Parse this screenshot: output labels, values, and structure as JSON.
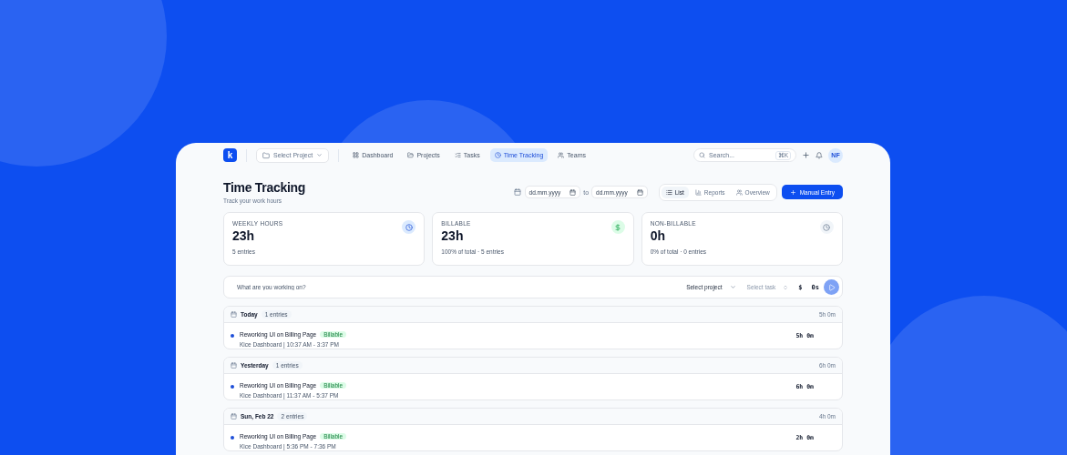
{
  "nav": {
    "logo": "k",
    "project_select": "Select Project",
    "links": [
      {
        "label": "Dashboard",
        "selected": false
      },
      {
        "label": "Projects",
        "selected": false
      },
      {
        "label": "Tasks",
        "selected": false
      },
      {
        "label": "Time Tracking",
        "selected": true
      },
      {
        "label": "Teams",
        "selected": false
      }
    ],
    "search": {
      "placeholder": "Search...",
      "shortcut": "⌘K"
    },
    "avatar": "NF"
  },
  "header": {
    "title": "Time Tracking",
    "subtitle": "Track your work hours",
    "date_from": "dd.mm.yyyy",
    "to_label": "to",
    "date_to": "dd.mm.yyyy",
    "views": [
      {
        "label": "List",
        "selected": true
      },
      {
        "label": "Reports",
        "selected": false
      },
      {
        "label": "Overview",
        "selected": false
      }
    ],
    "add_button": "Manual Entry"
  },
  "stats": [
    {
      "label": "WEEKLY HOURS",
      "value": "23h",
      "note": "5 entries"
    },
    {
      "label": "BILLABLE",
      "value": "23h",
      "note": "100% of total · 5 entries"
    },
    {
      "label": "NON-BILLABLE",
      "value": "0h",
      "note": "0% of total · 0 entries"
    }
  ],
  "timer": {
    "placeholder": "What are you working on?",
    "project": "Select project",
    "task_placeholder": "Select task",
    "billable_symbol": "$",
    "elapsed": "0s"
  },
  "groups": [
    {
      "title": "Today",
      "count": "1 entries",
      "total": "5h 0m",
      "entries": [
        {
          "title": "Reworking UI on Billing Page",
          "tag": "Billable",
          "meta": "Kice Dashboard | 10:37 AM - 3:37 PM",
          "duration": "5h 0m",
          "color": "#1d4ed8"
        }
      ]
    },
    {
      "title": "Yesterday",
      "count": "1 entries",
      "total": "6h 0m",
      "entries": [
        {
          "title": "Reworking UI on Billing Page",
          "tag": "Billable",
          "meta": "Kice Dashboard | 11:37 AM - 5:37 PM",
          "duration": "6h 0m",
          "color": "#1d4ed8"
        }
      ]
    },
    {
      "title": "Sun, Feb 22",
      "count": "2 entries",
      "total": "4h 0m",
      "entries": [
        {
          "title": "Reworking UI on Billing Page",
          "tag": "Billable",
          "meta": "Kice Dashboard | 5:36 PM - 7:36 PM",
          "duration": "2h 0m",
          "color": "#1d4ed8"
        }
      ]
    }
  ]
}
